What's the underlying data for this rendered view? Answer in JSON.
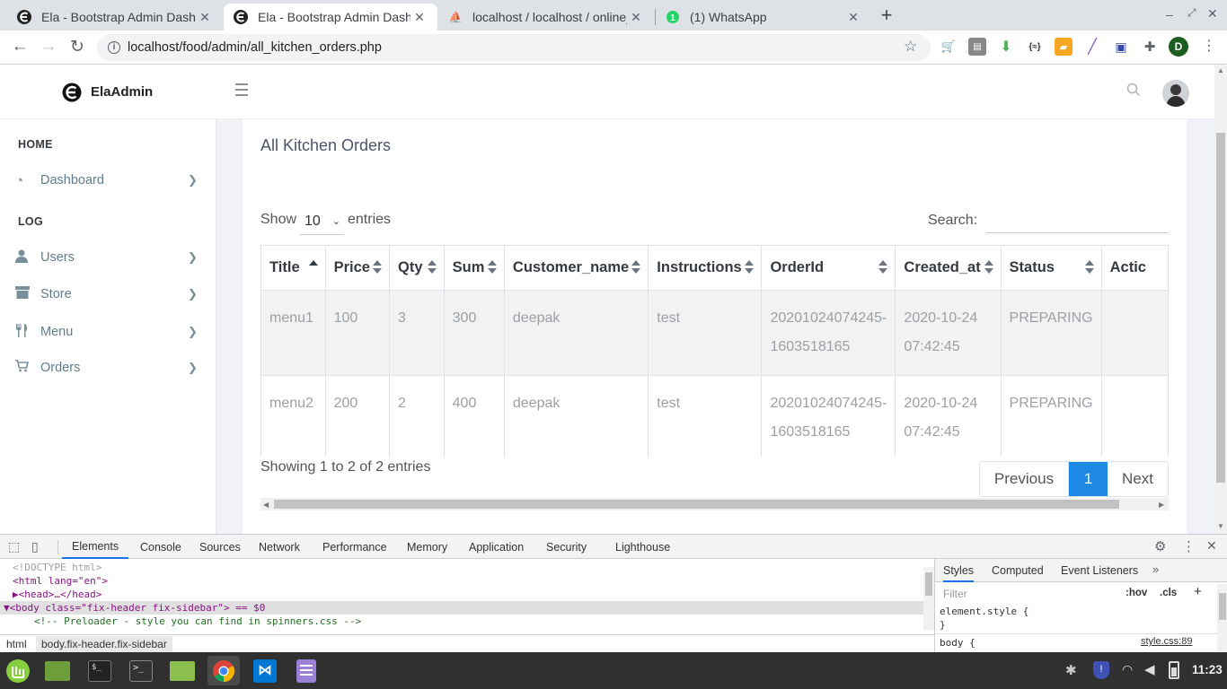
{
  "browser": {
    "tabs": [
      {
        "title": "Ela - Bootstrap Admin Dashbo",
        "icon": "ela-logo-icon"
      },
      {
        "title": "Ela - Bootstrap Admin Dashbo",
        "icon": "ela-logo-icon"
      },
      {
        "title": "localhost / localhost / online_",
        "icon": "phpmyadmin-icon"
      },
      {
        "title": "(1) WhatsApp",
        "icon": "whatsapp-icon"
      }
    ],
    "url": "localhost/food/admin/all_kitchen_orders.php",
    "profile_initial": "D"
  },
  "app": {
    "brand": "ElaAdmin",
    "sidebar": {
      "section_home": "HOME",
      "section_log": "LOG",
      "items": [
        {
          "label": "Dashboard",
          "icon": "dashboard-icon"
        },
        {
          "label": "Users",
          "icon": "user-icon"
        },
        {
          "label": "Store",
          "icon": "store-icon"
        },
        {
          "label": "Menu",
          "icon": "cutlery-icon"
        },
        {
          "label": "Orders",
          "icon": "cart-icon"
        }
      ]
    },
    "page_title": "All Kitchen Orders",
    "table_controls": {
      "show_label": "Show",
      "entries_value": "10",
      "entries_label": "entries",
      "search_label": "Search:"
    },
    "columns": [
      "Title",
      "Price",
      "Qty",
      "Sum",
      "Customer_name",
      "Instructions",
      "OrderId",
      "Created_at",
      "Status",
      "Actic"
    ],
    "rows": [
      {
        "title": "menu1",
        "price": "100",
        "qty": "3",
        "sum": "300",
        "customer": "deepak",
        "instructions": "test",
        "order_id_1": "20201024074245-",
        "order_id_2": "1603518165",
        "created_1": "2020-10-24",
        "created_2": "07:42:45",
        "status": "PREPARING"
      },
      {
        "title": "menu2",
        "price": "200",
        "qty": "2",
        "sum": "400",
        "customer": "deepak",
        "instructions": "test",
        "order_id_1": "20201024074245-",
        "order_id_2": "1603518165",
        "created_1": "2020-10-24",
        "created_2": "07:42:45",
        "status": "PREPARING"
      }
    ],
    "info": "Showing 1 to 2 of 2 entries",
    "pagination": {
      "previous": "Previous",
      "current": "1",
      "next": "Next"
    }
  },
  "devtools": {
    "tabs": [
      "Elements",
      "Console",
      "Sources",
      "Network",
      "Performance",
      "Memory",
      "Application",
      "Security",
      "Lighthouse"
    ],
    "code_lines": [
      "<!DOCTYPE html>",
      "<html lang=\"en\">",
      "▶<head>…</head>",
      "▼<body class=\"fix-header fix-sidebar\"> == $0",
      "<!-- Preloader - style you can find in spinners.css -->"
    ],
    "breadcrumb": [
      "html",
      "body.fix-header.fix-sidebar"
    ],
    "styles_tabs": [
      "Styles",
      "Computed",
      "Event Listeners"
    ],
    "filter_placeholder": "Filter",
    "hov": ":hov",
    "cls": ".cls",
    "element_style": "element.style {",
    "close_brace": "}",
    "body_rule": "body {",
    "style_source": "style.css:89"
  },
  "taskbar": {
    "time": "11:23"
  },
  "colors": {
    "accent": "#1e88e5",
    "tab_strip": "#dee1e6",
    "content_bg": "#f1f2f7",
    "taskbar": "#303030"
  }
}
